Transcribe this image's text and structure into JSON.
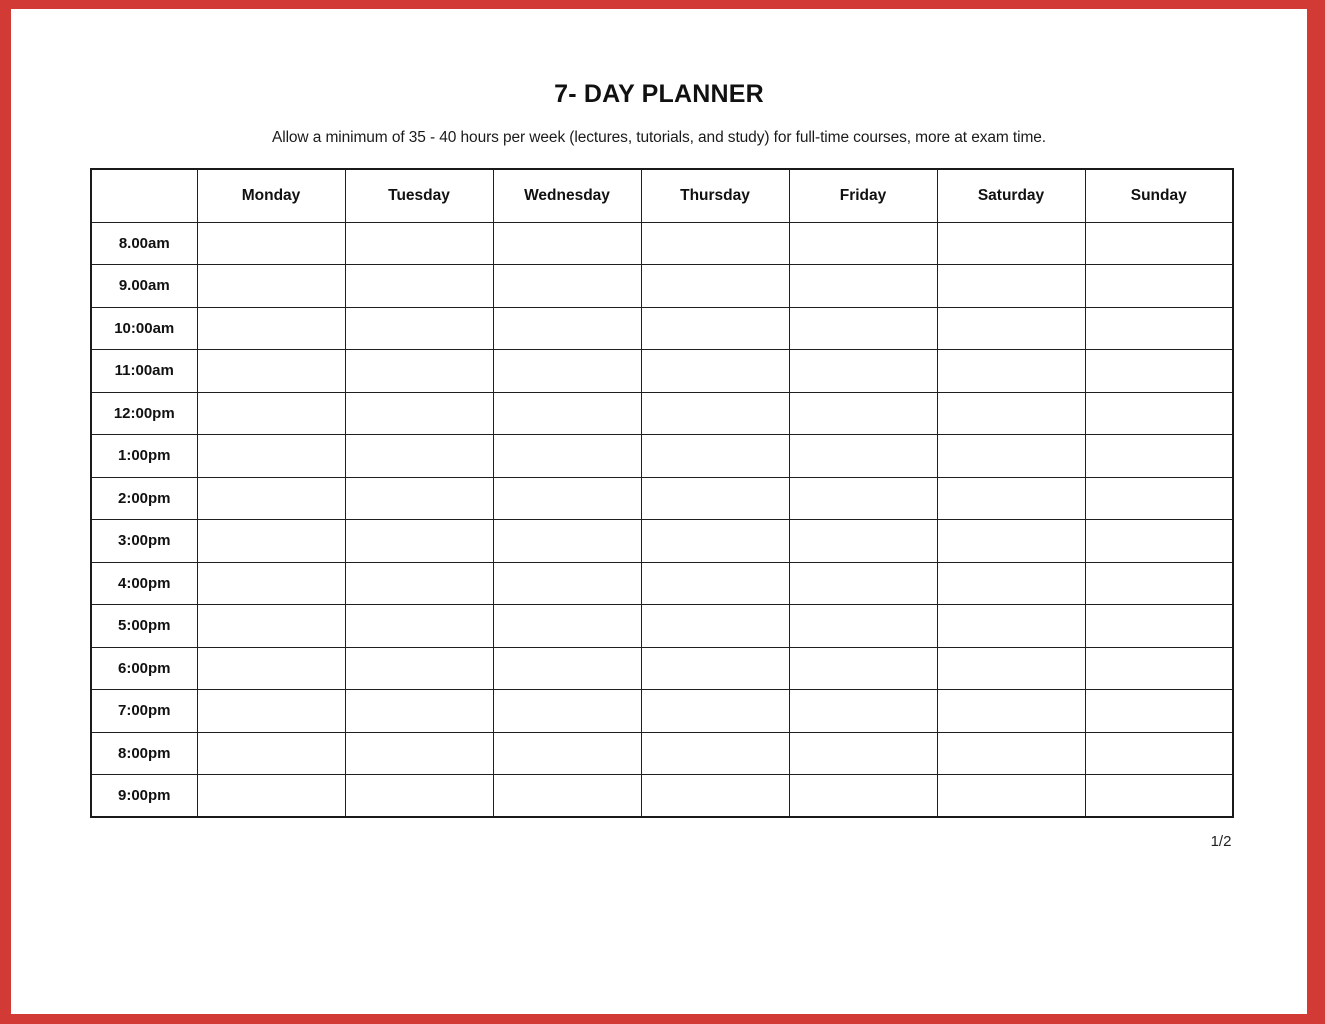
{
  "document": {
    "title": "7- DAY PLANNER",
    "subtitle": "Allow a minimum of 35 - 40 hours per week (lectures, tutorials, and study) for full-time courses, more at exam time.",
    "page_indicator": "1/2"
  },
  "theme": {
    "border_color": "#d13a35",
    "page_background": "#ffffff",
    "grid_color": "#1f1f1f",
    "text_color": "#111111"
  },
  "table": {
    "corner_header": "",
    "day_headers": [
      "Monday",
      "Tuesday",
      "Wednesday",
      "Thursday",
      "Friday",
      "Saturday",
      "Sunday"
    ],
    "time_rows": [
      "8.00am",
      "9.00am",
      "10:00am",
      "11:00am",
      "12:00pm",
      "1:00pm",
      "2:00pm",
      "3:00pm",
      "4:00pm",
      "5:00pm",
      "6:00pm",
      "7:00pm",
      "8:00pm",
      "9:00pm"
    ],
    "cells": [
      [
        "",
        "",
        "",
        "",
        "",
        "",
        ""
      ],
      [
        "",
        "",
        "",
        "",
        "",
        "",
        ""
      ],
      [
        "",
        "",
        "",
        "",
        "",
        "",
        ""
      ],
      [
        "",
        "",
        "",
        "",
        "",
        "",
        ""
      ],
      [
        "",
        "",
        "",
        "",
        "",
        "",
        ""
      ],
      [
        "",
        "",
        "",
        "",
        "",
        "",
        ""
      ],
      [
        "",
        "",
        "",
        "",
        "",
        "",
        ""
      ],
      [
        "",
        "",
        "",
        "",
        "",
        "",
        ""
      ],
      [
        "",
        "",
        "",
        "",
        "",
        "",
        ""
      ],
      [
        "",
        "",
        "",
        "",
        "",
        "",
        ""
      ],
      [
        "",
        "",
        "",
        "",
        "",
        "",
        ""
      ],
      [
        "",
        "",
        "",
        "",
        "",
        "",
        ""
      ],
      [
        "",
        "",
        "",
        "",
        "",
        "",
        ""
      ],
      [
        "",
        "",
        "",
        "",
        "",
        "",
        ""
      ]
    ]
  }
}
